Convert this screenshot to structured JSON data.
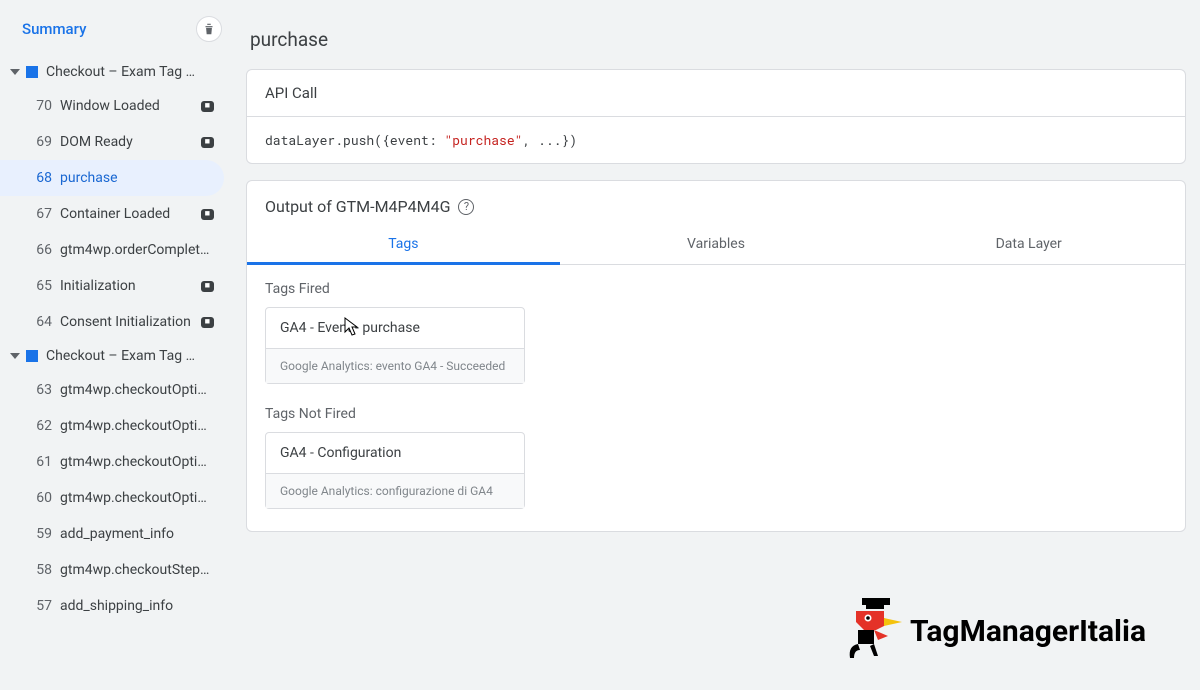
{
  "sidebar": {
    "summary": "Summary",
    "groups": [
      {
        "label": "Checkout – Exam Tag …",
        "events": [
          {
            "num": "70",
            "label": "Window Loaded",
            "chip": true
          },
          {
            "num": "69",
            "label": "DOM Ready",
            "chip": true
          },
          {
            "num": "68",
            "label": "purchase",
            "chip": false,
            "selected": true
          },
          {
            "num": "67",
            "label": "Container Loaded",
            "chip": true
          },
          {
            "num": "66",
            "label": "gtm4wp.orderComplete…",
            "chip": false
          },
          {
            "num": "65",
            "label": "Initialization",
            "chip": true
          },
          {
            "num": "64",
            "label": "Consent Initialization",
            "chip": true
          }
        ]
      },
      {
        "label": "Checkout – Exam Tag …",
        "events": [
          {
            "num": "63",
            "label": "gtm4wp.checkoutOptio…",
            "chip": false
          },
          {
            "num": "62",
            "label": "gtm4wp.checkoutOptio…",
            "chip": false
          },
          {
            "num": "61",
            "label": "gtm4wp.checkoutOptio…",
            "chip": false
          },
          {
            "num": "60",
            "label": "gtm4wp.checkoutOptio…",
            "chip": false
          },
          {
            "num": "59",
            "label": "add_payment_info",
            "chip": false
          },
          {
            "num": "58",
            "label": "gtm4wp.checkoutStepE…",
            "chip": false
          },
          {
            "num": "57",
            "label": "add_shipping_info",
            "chip": false
          }
        ]
      }
    ]
  },
  "main": {
    "title": "purchase",
    "api": {
      "label": "API Call",
      "code_pre": "dataLayer.push({event: ",
      "code_str": "\"purchase\"",
      "code_post": ", ...})"
    },
    "output": {
      "heading_pre": "Output of ",
      "container": "GTM-M4P4M4G",
      "tabs": [
        "Tags",
        "Variables",
        "Data Layer"
      ],
      "fired": {
        "label": "Tags Fired",
        "tag": {
          "name": "GA4 - Event - purchase",
          "detail": "Google Analytics: evento GA4 - Succeeded"
        }
      },
      "notfired": {
        "label": "Tags Not Fired",
        "tag": {
          "name": "GA4 - Configuration",
          "detail": "Google Analytics: configurazione di GA4"
        }
      }
    }
  },
  "brand": "TagManagerItalia"
}
